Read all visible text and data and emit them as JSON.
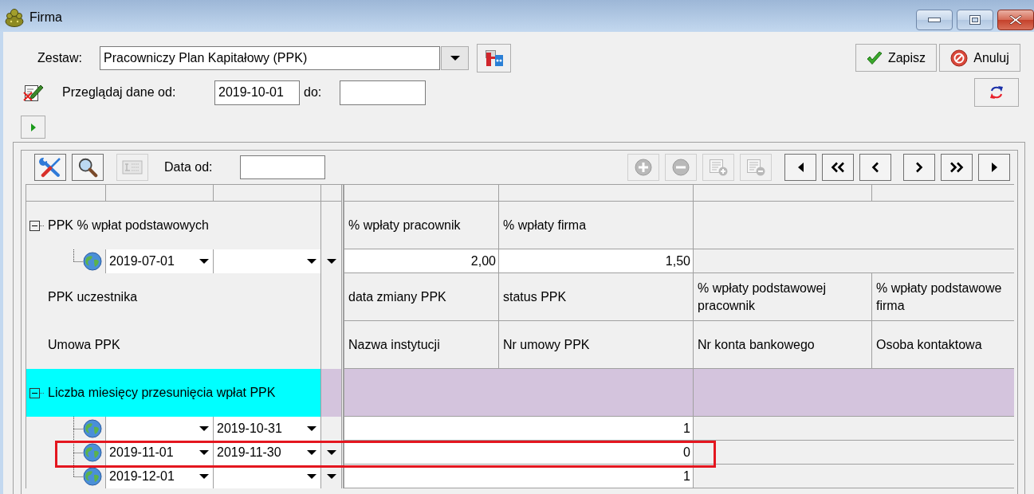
{
  "window": {
    "title": "Firma"
  },
  "form": {
    "set_label": "Zestaw:",
    "set_value": "Pracowniczy Plan Kapitałowy (PPK)",
    "browse_label": "Przeglądaj dane od:",
    "date_from": "2019-10-01",
    "date_to_label": "do:"
  },
  "actions": [
    {
      "kind": "save",
      "label": "Zapisz"
    },
    {
      "kind": "cancel",
      "label": "Anuluj"
    }
  ],
  "grid_toolbar": {
    "tools": [
      {
        "kind": "tools",
        "disabled": false
      },
      {
        "kind": "search",
        "disabled": false
      },
      {
        "kind": "calendar",
        "disabled": true
      }
    ],
    "date_label": "Data od:",
    "edit": [
      {
        "kind": "plus",
        "disabled": true
      },
      {
        "kind": "minus",
        "disabled": true
      },
      {
        "kind": "insert",
        "disabled": true
      },
      {
        "kind": "delete",
        "disabled": true
      }
    ],
    "navigation": [
      {
        "kind": "first",
        "disabled": false
      },
      {
        "kind": "rewind",
        "disabled": false
      },
      {
        "kind": "previous",
        "disabled": false
      },
      {
        "kind": "next",
        "disabled": false
      },
      {
        "kind": "forward",
        "disabled": false
      },
      {
        "kind": "last",
        "disabled": false
      }
    ]
  },
  "grid": {
    "rows": [
      {
        "kind": "group",
        "label": "PPK % wpłat podstawowych",
        "expanded": true,
        "selected": false,
        "cells": [
          "% wpłaty pracownik",
          "% wpłaty firma"
        ],
        "children": [
          {
            "from": "2019-07-01",
            "dropdown": true,
            "highlighted": false,
            "values": [
              "2,00",
              "1,50"
            ]
          }
        ]
      },
      {
        "kind": "section",
        "label": "PPK uczestnika",
        "cells": [
          "data zmiany PPK",
          "status PPK",
          "% wpłaty podstawowej\npracownik",
          "% wpłaty podstawowe\nfirma"
        ]
      },
      {
        "kind": "section",
        "label": "Umowa PPK",
        "cells": [
          "Nazwa instytucji",
          "Nr umowy PPK",
          "Nr konta bankowego",
          "Osoba kontaktowa"
        ]
      },
      {
        "kind": "group",
        "label": "Liczba miesięcy przesunięcia wpłat PPK",
        "expanded": true,
        "selected": true,
        "children": [
          {
            "to": "2019-10-31",
            "dropdown": false,
            "highlighted": false,
            "values": [
              "1"
            ]
          },
          {
            "from": "2019-11-01",
            "to": "2019-11-30",
            "dropdown": true,
            "highlighted": true,
            "values": [
              "0"
            ]
          },
          {
            "from": "2019-12-01",
            "dropdown": true,
            "highlighted": false,
            "values": [
              "1"
            ]
          }
        ]
      }
    ]
  }
}
